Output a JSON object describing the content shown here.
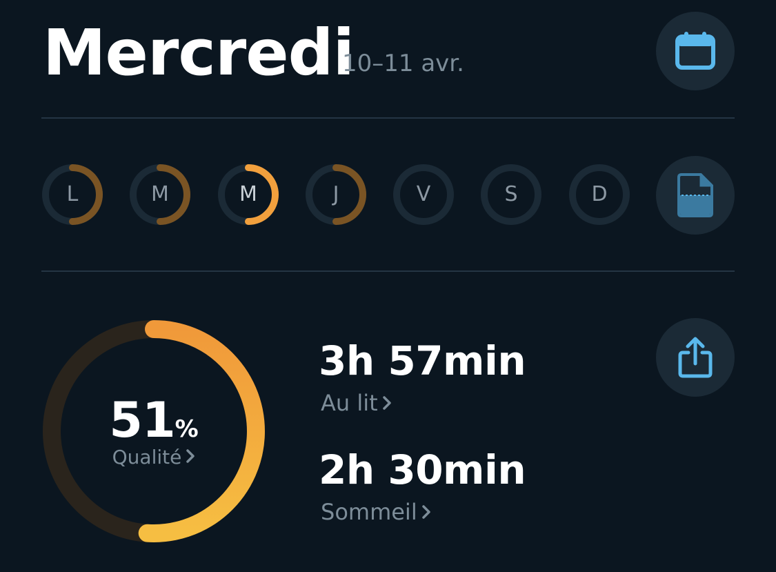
{
  "header": {
    "title": "Mercredi",
    "date": "10–11 avr."
  },
  "week": {
    "days": [
      {
        "label": "L",
        "progress": 0.5,
        "selected": false,
        "color": "#7a5424"
      },
      {
        "label": "M",
        "progress": 0.5,
        "selected": false,
        "color": "#7a5424"
      },
      {
        "label": "M",
        "progress": 0.5,
        "selected": true,
        "color": "#f2a03d"
      },
      {
        "label": "J",
        "progress": 0.5,
        "selected": false,
        "color": "#7a5424"
      },
      {
        "label": "V",
        "progress": 0,
        "selected": false,
        "color": "#7a5424"
      },
      {
        "label": "S",
        "progress": 0,
        "selected": false,
        "color": "#7a5424"
      },
      {
        "label": "D",
        "progress": 0,
        "selected": false,
        "color": "#7a5424"
      }
    ]
  },
  "quality": {
    "value": "51",
    "unit": "%",
    "label": "Qualité",
    "fraction": 0.51
  },
  "stats": {
    "in_bed_value": "3h 57min",
    "in_bed_label": "Au lit",
    "sleep_value": "2h 30min",
    "sleep_label": "Sommeil"
  },
  "colors": {
    "background": "#0b1620",
    "accent": "#f2a03d",
    "icon": "#5ab8ec"
  },
  "icons": {
    "calendar": "calendar-icon",
    "document": "document-icon",
    "share": "share-icon",
    "chevron": "chevron-right-icon"
  }
}
